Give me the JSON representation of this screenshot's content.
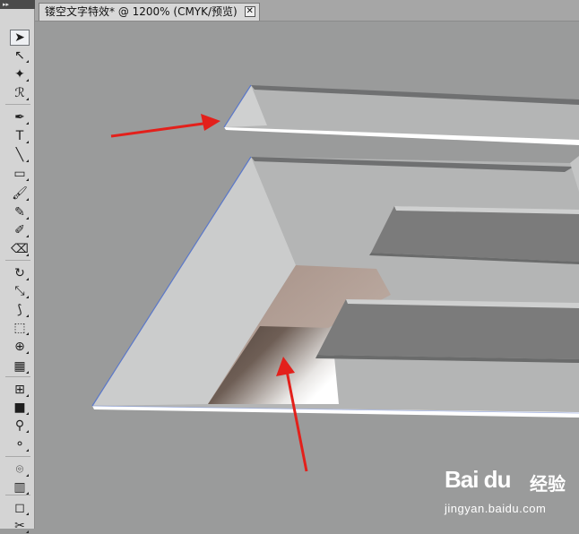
{
  "document_tab": {
    "title": "镂空文字特效* @ 1200% (CMYK/预览)",
    "close_glyph": "✕"
  },
  "toolbar": {
    "grip": "▸▸",
    "tools": [
      {
        "name": "selection-tool-icon",
        "glyph": "➤",
        "active": true
      },
      {
        "name": "direct-selection-tool-icon",
        "glyph": "↖"
      },
      {
        "name": "magic-wand-tool-icon",
        "glyph": "✦"
      },
      {
        "name": "lasso-tool-icon",
        "glyph": "ℛ"
      },
      {
        "name": "pen-tool-icon",
        "glyph": "✒"
      },
      {
        "name": "type-tool-icon",
        "glyph": "T"
      },
      {
        "name": "line-segment-tool-icon",
        "glyph": "╲"
      },
      {
        "name": "rectangle-tool-icon",
        "glyph": "▭"
      },
      {
        "name": "paintbrush-tool-icon",
        "glyph": "🖌"
      },
      {
        "name": "pencil-tool-icon",
        "glyph": "✎"
      },
      {
        "name": "blob-brush-tool-icon",
        "glyph": "✐"
      },
      {
        "name": "eraser-tool-icon",
        "glyph": "⌫"
      },
      {
        "name": "rotate-tool-icon",
        "glyph": "↻"
      },
      {
        "name": "scale-tool-icon",
        "glyph": "⤡"
      },
      {
        "name": "warp-tool-icon",
        "glyph": "⟆"
      },
      {
        "name": "free-transform-tool-icon",
        "glyph": "⬚"
      },
      {
        "name": "shape-builder-tool-icon",
        "glyph": "⊕"
      },
      {
        "name": "perspective-grid-tool-icon",
        "glyph": "▦"
      },
      {
        "name": "mesh-tool-icon",
        "glyph": "⊞"
      },
      {
        "name": "gradient-tool-icon",
        "glyph": "■"
      },
      {
        "name": "eyedropper-tool-icon",
        "glyph": "⚲"
      },
      {
        "name": "blend-tool-icon",
        "glyph": "⚬"
      },
      {
        "name": "symbol-sprayer-tool-icon",
        "glyph": "⌾"
      },
      {
        "name": "column-graph-tool-icon",
        "glyph": "▥"
      },
      {
        "name": "artboard-tool-icon",
        "glyph": "◻"
      },
      {
        "name": "slice-tool-icon",
        "glyph": "✂"
      }
    ]
  },
  "watermark": {
    "logo": "Bai du",
    "brand": "经验",
    "url": "jingyan.baidu.com"
  },
  "colors": {
    "canvas_bg": "#9a9b9b",
    "arrow": "#e3201b",
    "path_outline": "#5b78c9"
  }
}
